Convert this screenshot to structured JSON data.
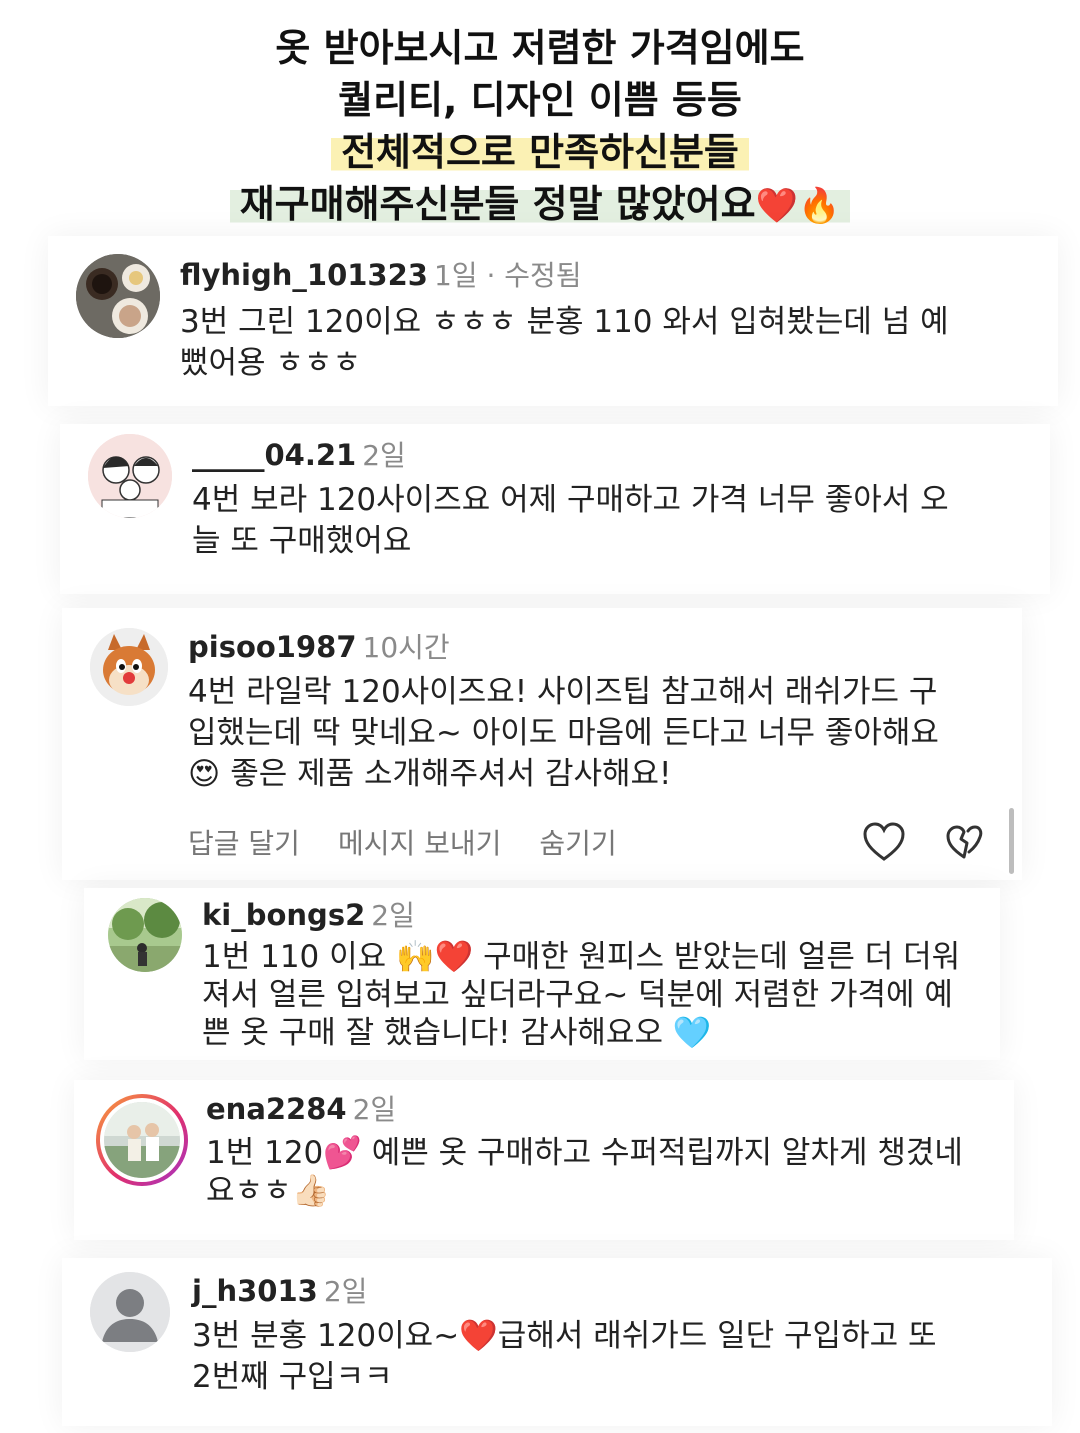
{
  "headline": {
    "line1": "옷 받아보시고 저렴한 가격임에도",
    "line2": "퀄리티, 디자인 이쁨 등등",
    "line3": "전체적으로 만족하신분들",
    "line4": "재구매해주신분들 정말 많았어요",
    "line4_emoji": "❤️🔥"
  },
  "comments": [
    {
      "username": "flyhigh_101323",
      "meta": "1일 · 수정됨",
      "text_l1": "3번 그린 120이요 ㅎㅎㅎ 분홍 110 와서 입혀봤는데 넘 예",
      "text_l2": "뻤어용 ㅎㅎㅎ"
    },
    {
      "username": "_____04.21",
      "meta": "2일",
      "text_l1": "4번 보라 120사이즈요 어제 구매하고 가격 너무 좋아서 오",
      "text_l2": "늘 또 구매했어요"
    },
    {
      "username": "pisoo1987",
      "meta": "10시간",
      "text_l1": "4번 라일락 120사이즈요! 사이즈팁 참고해서 래쉬가드 구",
      "text_l2": "입했는데 딱 맞네요~ 아이도 마음에 든다고 너무 좋아해요",
      "text_l3_emoji": "😍",
      "text_l3": "좋은 제품 소개해주셔서 감사해요!",
      "actions": {
        "reply": "답글 달기",
        "message": "메시지 보내기",
        "hide": "숨기기"
      }
    },
    {
      "username": "ki_bongs2",
      "meta": "2일",
      "text_l1a": "1번 110 이요",
      "text_l1_emoji": "🙌❤️",
      "text_l1b": "구매한 원피스 받았는데 얼른 더 더워",
      "text_l2": "져서 얼른 입혀보고 싶더라구요~ 덕분에 저렴한 가격에 예",
      "text_l3": "쁜 옷 구매 잘 했습니다! 감사해요오",
      "text_l3_emoji": "🩵"
    },
    {
      "username": "ena2284",
      "meta": "2일",
      "text_l1a": "1번 120",
      "text_l1_emoji": "💕",
      "text_l1b": "예쁜 옷 구매하고 수퍼적립까지 알차게 챙겼네",
      "text_l2": "요ㅎㅎ",
      "text_l2_emoji": "👍🏻"
    },
    {
      "username": "j_h3013",
      "meta": "2일",
      "text_l1a": "3번 분홍 120이요~",
      "text_l1_emoji": "❤️",
      "text_l1b": "급해서 래쉬가드 일단 구입하고 또",
      "text_l2": "2번째 구입ㅋㅋ"
    }
  ],
  "colors": {
    "highlight_yellow": "#fbf1b4",
    "highlight_green": "#e3efe0",
    "meta_gray": "#8a8a8a",
    "story_ring": "#e1306c"
  },
  "icons": [
    "heart-icon",
    "dislike-icon",
    "default-profile-icon"
  ]
}
